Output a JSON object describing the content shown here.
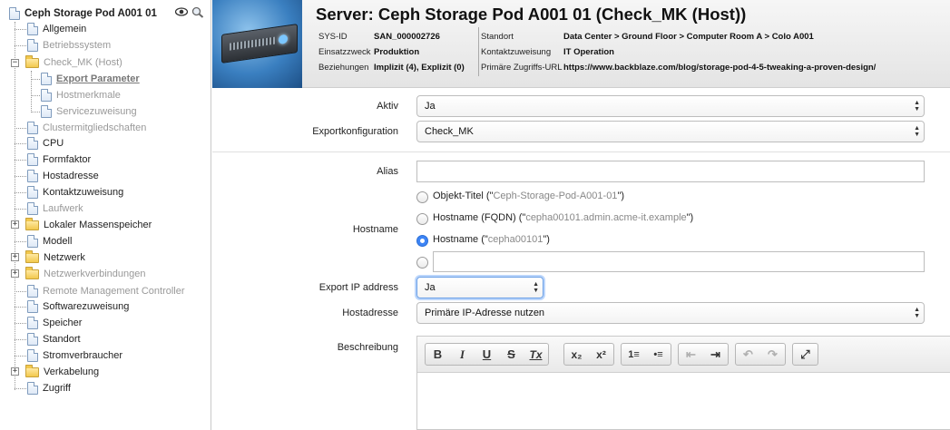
{
  "sidebar": {
    "root_title": "Ceph Storage Pod A001 01",
    "items": [
      {
        "label": "Allgemein",
        "style": "dark"
      },
      {
        "label": "Betriebssystem",
        "style": "gray"
      },
      {
        "label": "Check_MK (Host)",
        "style": "gray"
      },
      {
        "label": "Export Parameter",
        "style": "selected"
      },
      {
        "label": "Hostmerkmale",
        "style": "gray"
      },
      {
        "label": "Servicezuweisung",
        "style": "gray"
      },
      {
        "label": "Clustermitgliedschaften",
        "style": "gray"
      },
      {
        "label": "CPU",
        "style": "dark"
      },
      {
        "label": "Formfaktor",
        "style": "dark"
      },
      {
        "label": "Hostadresse",
        "style": "dark"
      },
      {
        "label": "Kontaktzuweisung",
        "style": "dark"
      },
      {
        "label": "Laufwerk",
        "style": "gray"
      },
      {
        "label": "Lokaler Massenspeicher",
        "style": "dark"
      },
      {
        "label": "Modell",
        "style": "dark"
      },
      {
        "label": "Netzwerk",
        "style": "dark"
      },
      {
        "label": "Netzwerkverbindungen",
        "style": "gray"
      },
      {
        "label": "Remote Management Controller",
        "style": "gray"
      },
      {
        "label": "Softwarezuweisung",
        "style": "dark"
      },
      {
        "label": "Speicher",
        "style": "dark"
      },
      {
        "label": "Standort",
        "style": "dark"
      },
      {
        "label": "Stromverbraucher",
        "style": "dark"
      },
      {
        "label": "Verkabelung",
        "style": "dark"
      },
      {
        "label": "Zugriff",
        "style": "dark"
      }
    ]
  },
  "header": {
    "title": "Server: Ceph Storage Pod A001 01 (Check_MK (Host))",
    "sysid_label": "SYS-ID",
    "sysid_value": "SAN_000002726",
    "einsatz_label": "Einsatzzweck",
    "einsatz_value": "Produktion",
    "bez_label": "Beziehungen",
    "bez_value": "Implizit (4), Explizit (0)",
    "standort_label": "Standort",
    "standort_value": "Data Center > Ground Floor > Computer Room A > Colo A001",
    "kontakt_label": "Kontaktzuweisung",
    "kontakt_value": "IT Operation",
    "url_label": "Primäre Zugriffs-URL",
    "url_value": "https://www.backblaze.com/blog/storage-pod-4-5-tweaking-a-proven-design/"
  },
  "form": {
    "aktiv_label": "Aktiv",
    "aktiv_value": "Ja",
    "exportkonf_label": "Exportkonfiguration",
    "exportkonf_value": "Check_MK",
    "alias_label": "Alias",
    "alias_value": "",
    "hostname_label": "Hostname",
    "hostname_options": [
      {
        "prefix": "Objekt-Titel (\"",
        "value": "Ceph-Storage-Pod-A001-01",
        "suffix": "\")",
        "selected": false
      },
      {
        "prefix": "Hostname (FQDN) (\"",
        "value": "cepha00101.admin.acme-it.example",
        "suffix": "\")",
        "selected": false
      },
      {
        "prefix": "Hostname (\"",
        "value": "cepha00101",
        "suffix": "\")",
        "selected": true
      }
    ],
    "hostname_custom_value": "",
    "export_ip_label": "Export IP address",
    "export_ip_value": "Ja",
    "hostadresse_label": "Hostadresse",
    "hostadresse_value": "Primäre IP-Adresse nutzen",
    "beschreibung_label": "Beschreibung"
  },
  "editor_toolbar": [
    {
      "name": "bold",
      "glyph": "B"
    },
    {
      "name": "italic",
      "glyph": "I"
    },
    {
      "name": "underline",
      "glyph": "U"
    },
    {
      "name": "strike",
      "glyph": "S"
    },
    {
      "name": "remove-format",
      "glyph": "Tx"
    },
    {
      "name": "subscript",
      "glyph": "x₂"
    },
    {
      "name": "superscript",
      "glyph": "x²"
    },
    {
      "name": "numbered-list",
      "glyph": "1≡"
    },
    {
      "name": "bulleted-list",
      "glyph": "•≡"
    },
    {
      "name": "outdent",
      "glyph": "⇤"
    },
    {
      "name": "indent",
      "glyph": "⇥"
    },
    {
      "name": "undo",
      "glyph": "↶"
    },
    {
      "name": "redo",
      "glyph": "↷"
    },
    {
      "name": "maximize",
      "glyph": "⤢"
    }
  ],
  "colors": {
    "accent_blue": "#3d84f5",
    "sidebar_gray_text": "#999999"
  }
}
